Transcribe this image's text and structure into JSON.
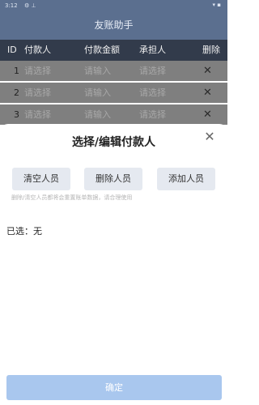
{
  "status_bar": {
    "time": "3:12",
    "notif_icons": "⚙ ⊥",
    "right_icons": "▾ ▪"
  },
  "app": {
    "title": "友账助手"
  },
  "table": {
    "headers": {
      "id": "ID",
      "payer": "付款人",
      "amount": "付款金额",
      "bearer": "承担人",
      "delete": "删除"
    },
    "rows": [
      {
        "id": "1",
        "payer": "请选择",
        "amount": "请输入",
        "bearer": "请选择",
        "delete": "✕"
      },
      {
        "id": "2",
        "payer": "请选择",
        "amount": "请输入",
        "bearer": "请选择",
        "delete": "✕"
      },
      {
        "id": "3",
        "payer": "请选择",
        "amount": "请输入",
        "bearer": "请选择",
        "delete": "✕"
      }
    ]
  },
  "sheet": {
    "title": "选择/编辑付款人",
    "close": "✕",
    "buttons": {
      "clear": "清空人员",
      "remove": "删除人员",
      "add": "添加人员"
    },
    "hint": "删除/清空人员都将会重置账单数据，请合理使用",
    "selected": "已选：无",
    "confirm": "确定"
  }
}
